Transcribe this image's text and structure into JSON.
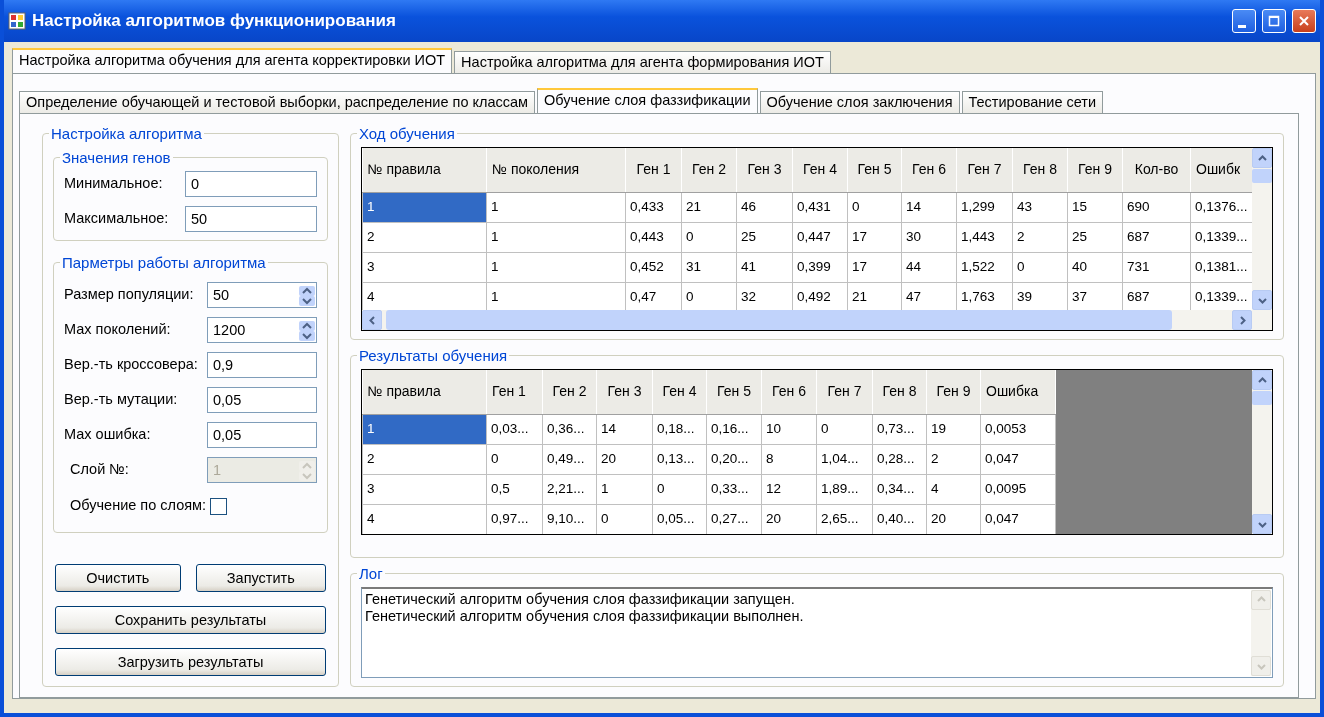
{
  "window": {
    "title": "Настройка алгоритмов функционирования"
  },
  "outer_tabs": [
    {
      "label": "Настройка алгоритма обучения для агента корректировки ИОТ",
      "selected": true
    },
    {
      "label": "Настройка алгоритма для агента формирования ИОТ",
      "selected": false
    }
  ],
  "inner_tabs": [
    {
      "label": "Определение обучающей и тестовой выборки, распределение по классам",
      "selected": false
    },
    {
      "label": "Обучение слоя фаззификации",
      "selected": true
    },
    {
      "label": "Обучение слоя заключения",
      "selected": false
    },
    {
      "label": "Тестирование сети",
      "selected": false
    }
  ],
  "settings": {
    "title": "Настройка алгоритма",
    "gene_values": {
      "title": "Значения генов",
      "fields": [
        {
          "label": "Минимальное:",
          "value": "0"
        },
        {
          "label": "Максимальное:",
          "value": "50"
        }
      ]
    },
    "params": {
      "title": "Парметры работы алгоритма",
      "fields": [
        {
          "kind": "spin",
          "label": "Размер популяции:",
          "value": "50",
          "disabled": false
        },
        {
          "kind": "spin",
          "label": "Мах поколений:",
          "value": "1200",
          "disabled": false
        },
        {
          "kind": "text",
          "label": "Вер.-ть кроссовера:",
          "value": "0,9",
          "disabled": false
        },
        {
          "kind": "text",
          "label": "Вер.-ть мутации:",
          "value": "0,05",
          "disabled": false
        },
        {
          "kind": "text",
          "label": "Мах ошибка:",
          "value": "0,05",
          "disabled": false
        },
        {
          "kind": "spin",
          "label": "Слой №:",
          "value": "1",
          "disabled": true
        }
      ],
      "checkbox": {
        "label": "Обучение по слоям:",
        "checked": false
      }
    },
    "buttons": [
      "Очистить",
      "Запустить",
      "Сохранить результаты",
      "Загрузить результаты"
    ]
  },
  "progress": {
    "title": "Ход обучения",
    "table": {
      "columns": [
        "№ правила",
        "№ поколения",
        "Ген 1",
        "Ген 2",
        "Ген 3",
        "Ген 4",
        "Ген 5",
        "Ген 6",
        "Ген 7",
        "Ген 8",
        "Ген 9",
        "Кол-во",
        "Ошибк"
      ],
      "rows": [
        {
          "selected": true,
          "cells": [
            "1",
            "1",
            "0,433",
            "21",
            "46",
            "0,431",
            "0",
            "14",
            "1,299",
            "43",
            "15",
            "690",
            "0,1376..."
          ]
        },
        {
          "selected": false,
          "cells": [
            "2",
            "1",
            "0,443",
            "0",
            "25",
            "0,447",
            "17",
            "30",
            "1,443",
            "2",
            "25",
            "687",
            "0,1339..."
          ]
        },
        {
          "selected": false,
          "cells": [
            "3",
            "1",
            "0,452",
            "31",
            "41",
            "0,399",
            "17",
            "44",
            "1,522",
            "0",
            "40",
            "731",
            "0,1381..."
          ]
        },
        {
          "selected": false,
          "cells": [
            "4",
            "1",
            "0,47",
            "0",
            "32",
            "0,492",
            "21",
            "47",
            "1,763",
            "39",
            "37",
            "687",
            "0,1339..."
          ]
        }
      ]
    }
  },
  "results": {
    "title": "Результаты обучения",
    "table": {
      "columns": [
        "№ правила",
        "Ген 1",
        "Ген 2",
        "Ген 3",
        "Ген 4",
        "Ген 5",
        "Ген 6",
        "Ген 7",
        "Ген 8",
        "Ген 9",
        "Ошибка"
      ],
      "rows": [
        {
          "selected": true,
          "cells": [
            "1",
            "0,03...",
            "0,36...",
            "14",
            "0,18...",
            "0,16...",
            "10",
            "0",
            "0,73...",
            "19",
            "0,0053"
          ]
        },
        {
          "selected": false,
          "cells": [
            "2",
            "0",
            "0,49...",
            "20",
            "0,13...",
            "0,20...",
            "8",
            "1,04...",
            "0,28...",
            "2",
            "0,047"
          ]
        },
        {
          "selected": false,
          "cells": [
            "3",
            "0,5",
            "2,21...",
            "1",
            "0",
            "0,33...",
            "12",
            "1,89...",
            "0,34...",
            "4",
            "0,0095"
          ]
        },
        {
          "selected": false,
          "cells": [
            "4",
            "0,97...",
            "9,10...",
            "0",
            "0,05...",
            "0,27...",
            "20",
            "2,65...",
            "0,40...",
            "20",
            "0,047"
          ]
        }
      ]
    }
  },
  "log": {
    "title": "Лог",
    "lines": [
      "Генетический алгоритм обучения слоя фаззификации запущен.",
      "Генетический алгоритм обучения слоя фаззификации выполнен."
    ]
  }
}
